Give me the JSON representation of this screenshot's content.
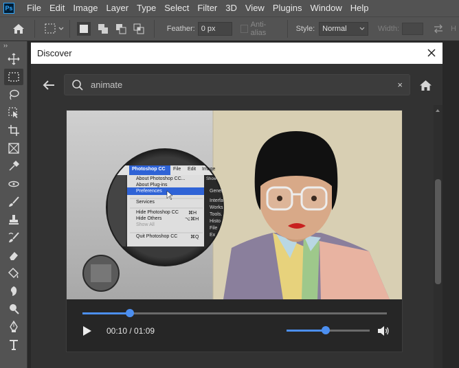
{
  "app": {
    "logo_text": "Ps"
  },
  "menu": [
    "File",
    "Edit",
    "Image",
    "Layer",
    "Type",
    "Select",
    "Filter",
    "3D",
    "View",
    "Plugins",
    "Window",
    "Help"
  ],
  "options": {
    "feather_label": "Feather:",
    "feather_value": "0 px",
    "antialias_label": "Anti-alias",
    "style_label": "Style:",
    "style_value": "Normal",
    "width_label": "Width:",
    "height_label": "H"
  },
  "toolbar": {
    "collapse": "››",
    "tools": [
      "move-icon",
      "marquee-icon",
      "lasso-icon",
      "object-select-icon",
      "crop-icon",
      "frame-icon",
      "eyedropper-icon",
      "healing-icon",
      "brush-icon",
      "stamp-icon",
      "history-brush-icon",
      "eraser-icon",
      "paint-bucket-icon",
      "smudge-icon",
      "dodge-icon",
      "pen-icon",
      "type-icon"
    ]
  },
  "dialog": {
    "title": "Discover",
    "search_query": "animate",
    "clear_label": "×"
  },
  "video": {
    "menu_app": "Photoshop CC",
    "menu_file": "File",
    "menu_edit": "Edit",
    "menu_image": "Image",
    "items": [
      "About Photoshop CC...",
      "About Plug-ins",
      "Preferences",
      "Services",
      "Hide Photoshop CC",
      "Hide Others",
      "Show All",
      "Quit Photoshop CC"
    ],
    "shortcuts": [
      "⌘H",
      "⌥⌘H",
      "⌘Q"
    ],
    "right_peek": [
      "Show",
      "Gener",
      "Interfa",
      "Works",
      "Tools.",
      "Histo",
      "File",
      "Ex"
    ]
  },
  "player": {
    "current_time": "00:10",
    "separator": " / ",
    "duration": "01:09",
    "progress_fraction": 0.156,
    "volume_fraction": 0.47,
    "accent_color": "#4c8ff0"
  }
}
